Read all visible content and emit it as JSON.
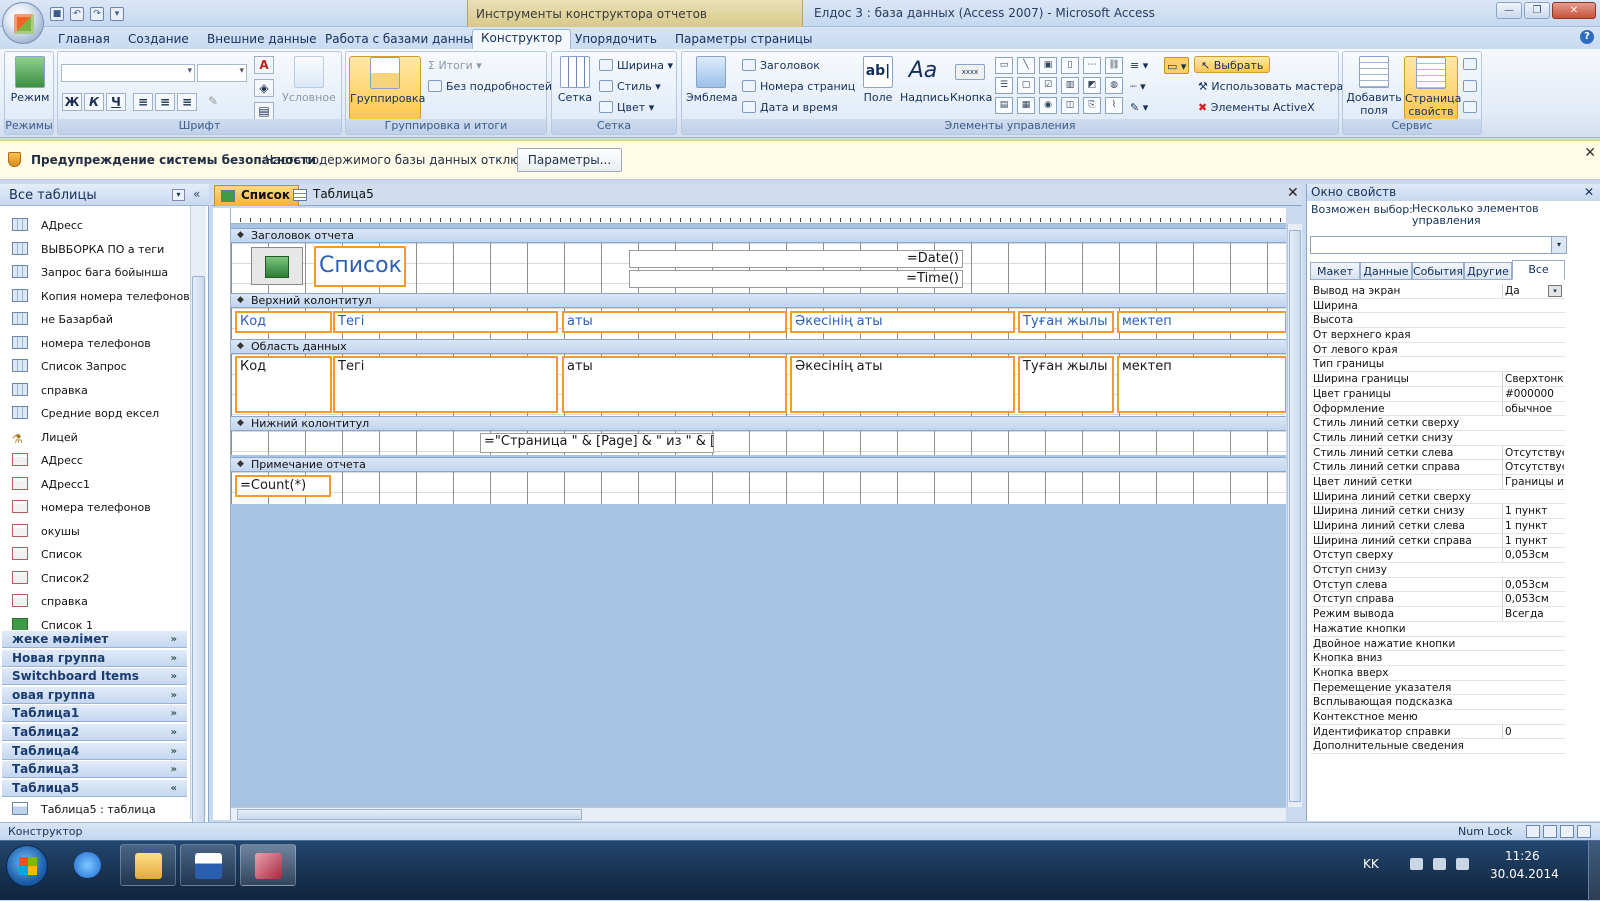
{
  "window": {
    "context_tab_title": "Инструменты конструктора отчетов",
    "app_title": "Елдос 3 : база данных (Access 2007) - Microsoft Access",
    "min_label": "—",
    "max_label": "❐",
    "close_label": "✕"
  },
  "ribbon_tabs": [
    "Главная",
    "Создание",
    "Внешние данные",
    "Работа с базами данных",
    "Конструктор",
    "Упорядочить",
    "Параметры страницы"
  ],
  "ribbon": {
    "views": {
      "mode_label": "Режим",
      "group_label": "Режимы"
    },
    "font": {
      "group_label": "Шрифт",
      "bold": "Ж",
      "italic": "К",
      "underline": "Ч",
      "cond_label": "Условное"
    },
    "grouping": {
      "group_label": "Группировка и итоги",
      "grouping_label": "Группировка",
      "totals_label": "Итоги",
      "hide_details_label": "Без подробностей"
    },
    "gridlines": {
      "group_label": "Сетка",
      "grid_label": "Сетка",
      "width_label": "Ширина",
      "style_label": "Стиль",
      "color_label": "Цвет"
    },
    "controls": {
      "group_label": "Элементы управления",
      "logo_label": "Эмблема",
      "title_label": "Заголовок",
      "pagenum_label": "Номера страниц",
      "datetime_label": "Дата и время",
      "field_label": "Поле",
      "label_label": "Надпись",
      "button_label": "Кнопка",
      "select_label": "Выбрать",
      "wizard_label": "Использовать мастера",
      "activex_label": "Элементы ActiveX"
    },
    "tools": {
      "group_label": "Сервис",
      "add_fields_label": "Добавить поля",
      "prop_sheet_label": "Страница свойств"
    }
  },
  "msgbar": {
    "title": "Предупреждение системы безопасности",
    "text": "Часть содержимого базы данных отключено",
    "button": "Параметры..."
  },
  "nav": {
    "header": "Все таблицы",
    "items": [
      {
        "label": "АДресс",
        "type": "query"
      },
      {
        "label": "ВЫВБОРКА  ПО а теги",
        "type": "query"
      },
      {
        "label": "Запрос бага бойынша",
        "type": "query"
      },
      {
        "label": "Копия номера телефонов",
        "type": "query"
      },
      {
        "label": "не Базарбай",
        "type": "query"
      },
      {
        "label": "номера телефонов",
        "type": "query"
      },
      {
        "label": "Список Запрос",
        "type": "query"
      },
      {
        "label": "справка",
        "type": "query"
      },
      {
        "label": "Средние ворд ексел",
        "type": "query"
      },
      {
        "label": "Лицей",
        "type": "macro"
      },
      {
        "label": "АДресс",
        "type": "report"
      },
      {
        "label": "АДресс1",
        "type": "report"
      },
      {
        "label": "номера телефонов",
        "type": "report"
      },
      {
        "label": "окушы",
        "type": "report"
      },
      {
        "label": "Список",
        "type": "report"
      },
      {
        "label": "Список2",
        "type": "report"
      },
      {
        "label": "справка",
        "type": "report"
      },
      {
        "label": "Список 1",
        "type": "form"
      }
    ],
    "groups": [
      {
        "label": "жеке мәлімет",
        "chev": "»"
      },
      {
        "label": "Новая группа",
        "chev": "»"
      },
      {
        "label": "Switchboard Items",
        "chev": "»"
      },
      {
        "label": "овая группа",
        "chev": "»"
      },
      {
        "label": "Таблица1",
        "chev": "»"
      },
      {
        "label": "Таблица2",
        "chev": "»"
      },
      {
        "label": "Таблица4",
        "chev": "»"
      },
      {
        "label": "Таблица3",
        "chev": "»"
      },
      {
        "label": "Таблица5",
        "chev": "«"
      }
    ],
    "expanded_item": "Таблица5 : таблица"
  },
  "doc_tabs": [
    {
      "label": "Список"
    },
    {
      "label": "Таблица5"
    }
  ],
  "report": {
    "sections": {
      "report_header": "Заголовок отчета",
      "page_header": "Верхний колонтитул",
      "detail": "Область данных",
      "page_footer": "Нижний колонтитул",
      "report_footer": "Примечание отчета"
    },
    "title": "Список",
    "date_expr": "=Date()",
    "time_expr": "=Time()",
    "columns": [
      "Код",
      "Тегі",
      "аты",
      "Әкесінің аты",
      "Туған жылы",
      "мектеп"
    ],
    "page_expr": "=\"Страница \" & [Page] & \" из \" & [Pages]",
    "count_expr": "=Count(*)"
  },
  "props": {
    "title": "Окно свойств",
    "selection_label": "Возможен выбор:",
    "selection_value": "Несколько элементов управления",
    "tabs": [
      "Макет",
      "Данные",
      "События",
      "Другие",
      "Все"
    ],
    "rows": [
      {
        "k": "Вывод на экран",
        "v": "Да"
      },
      {
        "k": "Ширина",
        "v": ""
      },
      {
        "k": "Высота",
        "v": ""
      },
      {
        "k": "От верхнего края",
        "v": ""
      },
      {
        "k": "От левого края",
        "v": ""
      },
      {
        "k": "Тип границы",
        "v": ""
      },
      {
        "k": "Ширина границы",
        "v": "Сверхтонкая"
      },
      {
        "k": "Цвет границы",
        "v": "#000000"
      },
      {
        "k": "Оформление",
        "v": "обычное"
      },
      {
        "k": "Стиль линий сетки сверху",
        "v": ""
      },
      {
        "k": "Стиль линий сетки снизу",
        "v": ""
      },
      {
        "k": "Стиль линий сетки слева",
        "v": "Отсутствует"
      },
      {
        "k": "Стиль линий сетки справа",
        "v": "Отсутствует"
      },
      {
        "k": "Цвет линий сетки",
        "v": "Границы и"
      },
      {
        "k": "Ширина линий сетки сверху",
        "v": ""
      },
      {
        "k": "Ширина линий сетки снизу",
        "v": "1 пункт"
      },
      {
        "k": "Ширина линий сетки слева",
        "v": "1 пункт"
      },
      {
        "k": "Ширина линий сетки справа",
        "v": "1 пункт"
      },
      {
        "k": "Отступ сверху",
        "v": "0,053см"
      },
      {
        "k": "Отступ снизу",
        "v": ""
      },
      {
        "k": "Отступ слева",
        "v": "0,053см"
      },
      {
        "k": "Отступ справа",
        "v": "0,053см"
      },
      {
        "k": "Режим вывода",
        "v": "Всегда"
      },
      {
        "k": "Нажатие кнопки",
        "v": ""
      },
      {
        "k": "Двойное нажатие кнопки",
        "v": ""
      },
      {
        "k": "Кнопка вниз",
        "v": ""
      },
      {
        "k": "Кнопка вверх",
        "v": ""
      },
      {
        "k": "Перемещение указателя",
        "v": ""
      },
      {
        "k": "Всплывающая подсказка",
        "v": ""
      },
      {
        "k": "Контекстное меню",
        "v": ""
      },
      {
        "k": "Идентификатор справки",
        "v": "0"
      },
      {
        "k": "Дополнительные сведения",
        "v": ""
      }
    ]
  },
  "status": {
    "left": "Конструктор",
    "numlock": "Num Lock"
  },
  "taskbar": {
    "lang": "KK",
    "time": "11:26",
    "date": "30.04.2014"
  },
  "colors": {
    "selection_orange": "#f39a2d",
    "ribbon_blue": "#dfe9f7",
    "warning_bg": "#fffbe6"
  }
}
